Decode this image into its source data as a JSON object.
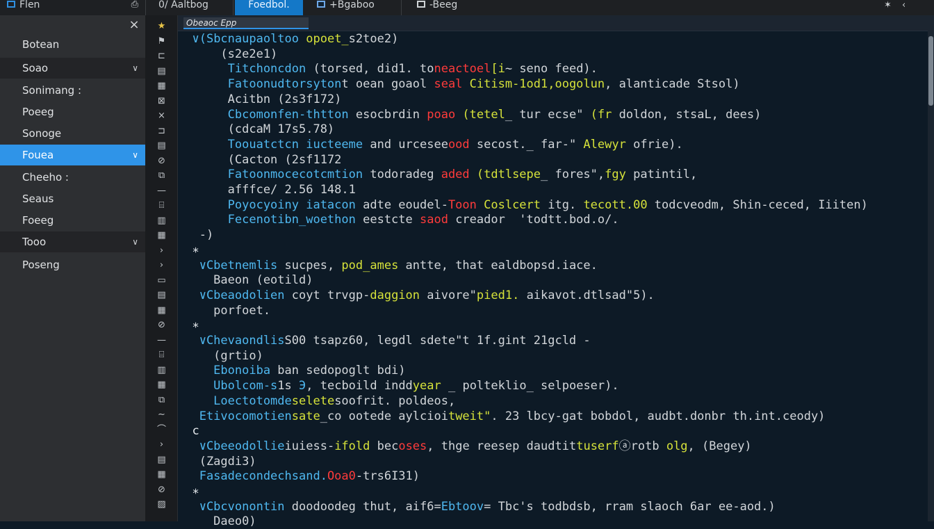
{
  "window": {
    "tabs": [
      {
        "label": "Flen",
        "icon": "file-icon"
      },
      {
        "label": "0/ Aaltbog",
        "icon": ""
      },
      {
        "label": "Foedbol.",
        "icon": "",
        "active": true
      },
      {
        "label": "+Bgaboo",
        "icon": "image-icon"
      },
      {
        "label": "-Beeg",
        "icon": "document-icon"
      }
    ]
  },
  "sidebar": {
    "close_glyph": "×",
    "items": [
      {
        "label": "Botean",
        "style": "normal",
        "chevron": false
      },
      {
        "label": "Soao",
        "style": "dark",
        "chevron": true
      },
      {
        "label": "Sonimang :",
        "style": "normal",
        "chevron": false
      },
      {
        "label": "Poeeg",
        "style": "normal",
        "chevron": false
      },
      {
        "label": "Sonoge",
        "style": "normal",
        "chevron": false
      },
      {
        "label": "Fouea",
        "style": "selected",
        "chevron": true
      },
      {
        "label": "Cheeho :",
        "style": "normal",
        "chevron": false
      },
      {
        "label": "Seaus",
        "style": "normal",
        "chevron": false
      },
      {
        "label": "Foeeg",
        "style": "normal",
        "chevron": false
      },
      {
        "label": "Tooo",
        "style": "dark",
        "chevron": true
      },
      {
        "label": "Poseng",
        "style": "normal",
        "chevron": false
      }
    ]
  },
  "gutter": {
    "icons": [
      {
        "name": "star-icon",
        "glyph": "★"
      },
      {
        "name": "flag-icon",
        "glyph": "⚑"
      },
      {
        "name": "panel-icon",
        "glyph": "⊏"
      },
      {
        "name": "grid-icon",
        "glyph": "▤"
      },
      {
        "name": "table-icon",
        "glyph": "▦"
      },
      {
        "name": "list-icon",
        "glyph": "⊠"
      },
      {
        "name": "close-icon",
        "glyph": "×"
      },
      {
        "name": "return-icon",
        "glyph": "⊐"
      },
      {
        "name": "doc-icon",
        "glyph": "▤"
      },
      {
        "name": "split-icon",
        "glyph": "⊘"
      },
      {
        "name": "layers-icon",
        "glyph": "⧉"
      },
      {
        "name": "minus-icon",
        "glyph": "—"
      },
      {
        "name": "bookmark-icon",
        "glyph": "⌸"
      },
      {
        "name": "columns-icon",
        "glyph": "▥"
      },
      {
        "name": "grid-alt-icon",
        "glyph": "▦"
      },
      {
        "name": "chevron-right-icon",
        "glyph": "›"
      },
      {
        "name": "chevron-right-icon-2",
        "glyph": "›"
      },
      {
        "name": "square-icon",
        "glyph": "▭"
      },
      {
        "name": "list-alt-icon",
        "glyph": "▤"
      },
      {
        "name": "table-alt-icon",
        "glyph": "▦"
      },
      {
        "name": "split-alt-icon",
        "glyph": "⊘"
      },
      {
        "name": "dash-icon",
        "glyph": "—"
      },
      {
        "name": "frame-icon",
        "glyph": "⌸"
      },
      {
        "name": "chart-icon",
        "glyph": "▥"
      },
      {
        "name": "grid2-icon",
        "glyph": "▦"
      },
      {
        "name": "layers2-icon",
        "glyph": "⧉"
      },
      {
        "name": "tilde-icon",
        "glyph": "∼"
      },
      {
        "name": "arc-icon",
        "glyph": "⌒"
      },
      {
        "name": "arrow-icon",
        "glyph": "›"
      },
      {
        "name": "table2-icon",
        "glyph": "▤"
      },
      {
        "name": "stack-icon",
        "glyph": "▦"
      },
      {
        "name": "split2-icon",
        "glyph": "⊘"
      },
      {
        "name": "image-icon",
        "glyph": "▨"
      }
    ]
  },
  "editor": {
    "tab_label": "Obeaoc Epp",
    "lines": [
      [
        [
          "c",
          "  ∨"
        ],
        [
          "c",
          "(Sbcnaupaoltoo "
        ],
        [
          "g",
          "opoet_"
        ],
        [
          "k",
          "s2toe2)"
        ]
      ],
      [
        [
          "k",
          "      (s2e2e1)"
        ]
      ],
      [
        [
          "c",
          "       Titchoncdon "
        ],
        [
          "k",
          "(torsed, did1. to"
        ],
        [
          "r",
          "neactoel"
        ],
        [
          "g",
          "[i"
        ],
        [
          "k",
          "~ seno feed)."
        ]
      ],
      [
        [
          "c",
          "       Fatoonudtorsyton"
        ],
        [
          "k",
          "t oean goaol "
        ],
        [
          "r",
          "seal "
        ],
        [
          "g",
          "Citism-1od1,oogolun"
        ],
        [
          "k",
          ", alanticade Stsol)"
        ]
      ],
      [
        [
          "k",
          "       Acitbn (2s3f172)"
        ]
      ],
      [
        [
          "c",
          "       Cbcomonfen-thtton "
        ],
        [
          "k",
          "esocbrdin "
        ],
        [
          "r",
          "poao "
        ],
        [
          "g",
          "(tetel"
        ],
        [
          "k",
          "_ tur ecse\" "
        ],
        [
          "g",
          "(fr "
        ],
        [
          "k",
          "doldon, stsaL, dees)"
        ]
      ],
      [
        [
          "k",
          "       (cdcaM 17s5.78)"
        ]
      ],
      [
        [
          "c",
          "       Toouatctcn iucteeme "
        ],
        [
          "k",
          "and urcesee"
        ],
        [
          "r",
          "ood "
        ],
        [
          "k",
          "secost._ far-\" "
        ],
        [
          "g",
          "Alewyr "
        ],
        [
          "k",
          "ofrie)."
        ]
      ],
      [
        [
          "k",
          "       (Cacton (2sf1172"
        ]
      ],
      [
        [
          "c",
          "       Fatoonmocecotcmtion "
        ],
        [
          "k",
          "todoradeg "
        ],
        [
          "r",
          "aded "
        ],
        [
          "g",
          "(tdtlsepe"
        ],
        [
          "k",
          "_ fores\","
        ],
        [
          "g",
          "fgy "
        ],
        [
          "k",
          "patintil,"
        ]
      ],
      [
        [
          "k",
          "       afffce/ 2.56 148.1"
        ]
      ],
      [
        [
          "c",
          "       Poyocyoiny iatacon "
        ],
        [
          "k",
          "adte eoudel-"
        ],
        [
          "r",
          "Toon "
        ],
        [
          "g",
          "Coslcert "
        ],
        [
          "k",
          "itg. "
        ],
        [
          "g",
          "tecott.00 "
        ],
        [
          "k",
          "todcveodm, Shin-ceced, Iiiten)"
        ]
      ],
      [
        [
          "c",
          "       Fecenotibn_woethon "
        ],
        [
          "k",
          "eestcte "
        ],
        [
          "r",
          "saod "
        ],
        [
          "k",
          "creador  'todtt.bod.o/."
        ]
      ],
      [
        [
          "k",
          "   -)"
        ]
      ],
      [
        [
          "w",
          "  ∗"
        ]
      ],
      [
        [
          "c",
          "   ∨Cbetnemlis "
        ],
        [
          "k",
          "sucpes, "
        ],
        [
          "g",
          "pod_ames "
        ],
        [
          "k",
          "antte, that ealdbopsd.iace."
        ]
      ],
      [
        [
          "k",
          "     Baeon (eotild)"
        ]
      ],
      [
        [
          "c",
          "   ∨Cbeaodolien "
        ],
        [
          "k",
          "coyt trvgp-"
        ],
        [
          "g",
          "daggion "
        ],
        [
          "k",
          "aivore\""
        ],
        [
          "g",
          "pied1. "
        ],
        [
          "k",
          "aikavot.dtlsad\"5)."
        ]
      ],
      [
        [
          "k",
          "     porfoet."
        ]
      ],
      [
        [
          "w",
          "  ∗"
        ]
      ],
      [
        [
          "c",
          "   ∨Chevaondlis"
        ],
        [
          "k",
          "S00 tsapz60, legdl sdete\"t 1f.gint 21gcld -"
        ]
      ],
      [
        [
          "k",
          "     (grtio)"
        ]
      ],
      [
        [
          "c",
          "     Ebonoiba "
        ],
        [
          "k",
          "ban sedopoglt bdi)"
        ]
      ],
      [
        [
          "c",
          "     Ubolcom-s"
        ],
        [
          "k",
          "1s "
        ],
        [
          "c",
          "Э"
        ],
        [
          "k",
          ", tecboild indd"
        ],
        [
          "g",
          "year "
        ],
        [
          "k",
          "_ polteklio_ selpoeser)."
        ]
      ],
      [
        [
          "c",
          "     Loectotomde"
        ],
        [
          "g",
          "selete"
        ],
        [
          "k",
          "soofrit. poldeos,"
        ]
      ],
      [
        [
          "c",
          "   Etivocomotien"
        ],
        [
          "g",
          "sate"
        ],
        [
          "k",
          "_co ootede aylcioi"
        ],
        [
          "g",
          "tweit\""
        ],
        [
          "k",
          ". 23 lbcy-gat bobdol, audbt.donbr th.int.ceody)"
        ]
      ],
      [
        [
          "w",
          "  c"
        ]
      ],
      [
        [
          "c",
          "   ∨Cbeeodollie"
        ],
        [
          "k",
          "iuiess-"
        ],
        [
          "g",
          "ifold "
        ],
        [
          "k",
          "bec"
        ],
        [
          "r",
          "oses"
        ],
        [
          "k",
          ", thge reesep daudtit"
        ],
        [
          "g",
          "tuserf"
        ],
        [
          "k",
          "ⓐrotb "
        ],
        [
          "g",
          "olg"
        ],
        [
          "k",
          ", (Begey)"
        ]
      ],
      [
        [
          "k",
          "   (Zagdi3)"
        ]
      ],
      [
        [
          "c",
          "   Fasadecondechsand."
        ],
        [
          "r",
          "Ooa0"
        ],
        [
          "k",
          "-trs6I31)"
        ]
      ],
      [
        [
          "w",
          "  ∗"
        ]
      ],
      [
        [
          "c",
          "   ∨Cbcvonontin "
        ],
        [
          "k",
          "doodoodeg thut, aif6="
        ],
        [
          "c",
          "Ebtoov"
        ],
        [
          "k",
          "= Tbc's todbdsb, rram slaoch 6ar ee-aod.)"
        ]
      ],
      [
        [
          "k",
          "     Daeo0)"
        ]
      ]
    ]
  }
}
